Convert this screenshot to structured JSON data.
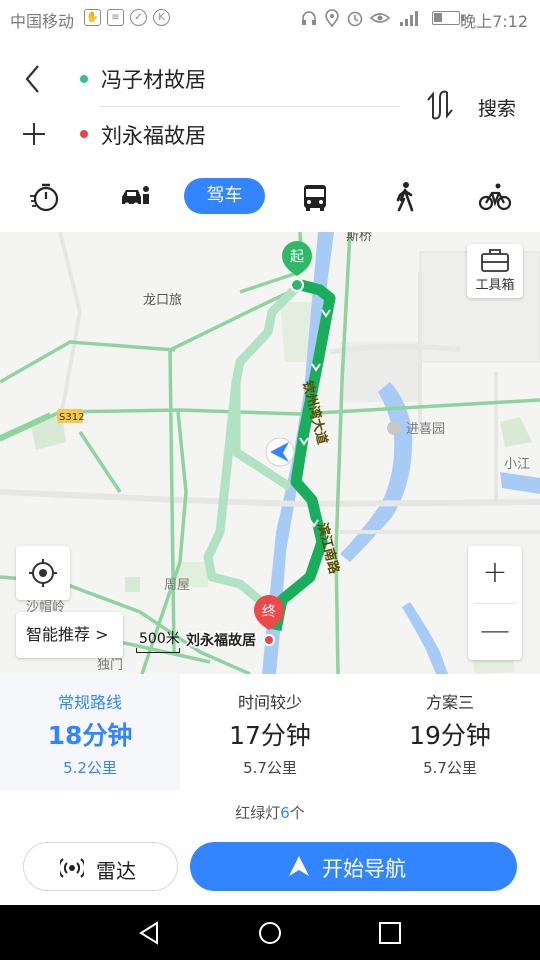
{
  "status_bar": {
    "carrier": "中国移动",
    "time": "晚上7:12",
    "left_icons": [
      "notification-icon",
      "list-icon",
      "shield-icon",
      "k-badge-icon"
    ],
    "right_icons": [
      "headset-icon",
      "location-icon",
      "alarm-icon",
      "eye-icon",
      "signal-icon",
      "battery-icon"
    ],
    "k_badge_text": "K"
  },
  "route_header": {
    "start_point": "冯子材故居",
    "end_point": "刘永福故居",
    "search_label": "搜索"
  },
  "transport_modes": {
    "active": "驾车",
    "items": [
      "timer-icon",
      "taxi-icon",
      "drive",
      "bus-icon",
      "walk-icon",
      "bike-icon"
    ]
  },
  "map": {
    "labels": {
      "longkou": "龙口旅",
      "bridge": "斯桥",
      "s312": "S312",
      "jinxiangyuan": "进喜园",
      "xiaojiang": "小江",
      "zhouwu": "周屋",
      "shapaling": "沙帽岭",
      "dulu": "独门",
      "road_qinzhou": "钦州湾大道",
      "road_binjiang": "滨江南路",
      "start_marker": "起",
      "end_marker": "终",
      "end_name": "刘永福故居"
    },
    "toolbox_label": "工具箱",
    "smart_recommend_label": "智能推荐",
    "smart_recommend_chevron": ">",
    "zoom_in_label": "+",
    "zoom_out_label": "—",
    "scale_label": "500米",
    "colors": {
      "route_main": "#1aad5b",
      "route_alt": "#a8dcbe",
      "road_green": "#5cc97a",
      "water": "#a8cbf5"
    }
  },
  "route_options": [
    {
      "name": "常规路线",
      "time": "18分钟",
      "distance": "5.2公里",
      "selected": true
    },
    {
      "name": "时间较少",
      "time": "17分钟",
      "distance": "5.7公里",
      "selected": false
    },
    {
      "name": "方案三",
      "time": "19分钟",
      "distance": "5.7公里",
      "selected": false
    }
  ],
  "traffic_lights": {
    "prefix": "红绿灯",
    "count": "6",
    "suffix": "个"
  },
  "actions": {
    "radar": "雷达",
    "start_navigation": "开始导航"
  },
  "accent_color": "#3385ff"
}
